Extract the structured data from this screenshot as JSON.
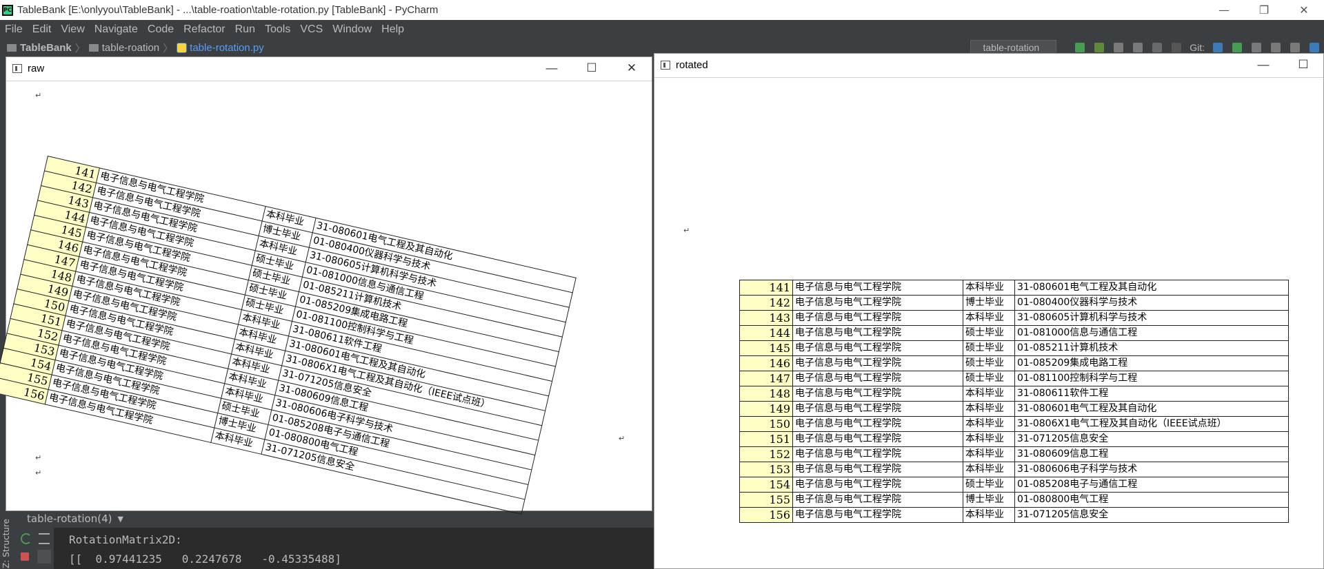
{
  "window": {
    "title": "TableBank [E:\\onlyyou\\TableBank] - ...\\table-roation\\table-rotation.py [TableBank] - PyCharm",
    "app_icon_text": "PC"
  },
  "menu": {
    "items": [
      "File",
      "Edit",
      "View",
      "Navigate",
      "Code",
      "Refactor",
      "Run",
      "Tools",
      "VCS",
      "Window",
      "Help"
    ]
  },
  "breadcrumb": {
    "project": "TableBank",
    "folder": "table-roation",
    "file": "table-rotation.py"
  },
  "toolbar": {
    "run_config": "table-rotation",
    "git_label": "Git:"
  },
  "sidebar": {
    "structure_label": "Z: Structure"
  },
  "run_panel": {
    "tab_label": "table-rotation(4)",
    "output_line1": "RotationMatrix2D:",
    "output_line2": "[[  0.97441235   0.2247678   -0.45335488]"
  },
  "raw_window": {
    "title": "raw"
  },
  "rotated_window": {
    "title": "rotated"
  },
  "table": {
    "rows": [
      {
        "num": "141",
        "school": "电子信息与电气工程学院",
        "degree": "本科毕业",
        "major": "31-080601电气工程及其自动化"
      },
      {
        "num": "142",
        "school": "电子信息与电气工程学院",
        "degree": "博士毕业",
        "major": "01-080400仪器科学与技术"
      },
      {
        "num": "143",
        "school": "电子信息与电气工程学院",
        "degree": "本科毕业",
        "major": "31-080605计算机科学与技术"
      },
      {
        "num": "144",
        "school": "电子信息与电气工程学院",
        "degree": "硕士毕业",
        "major": "01-081000信息与通信工程"
      },
      {
        "num": "145",
        "school": "电子信息与电气工程学院",
        "degree": "硕士毕业",
        "major": "01-085211计算机技术"
      },
      {
        "num": "146",
        "school": "电子信息与电气工程学院",
        "degree": "硕士毕业",
        "major": "01-085209集成电路工程"
      },
      {
        "num": "147",
        "school": "电子信息与电气工程学院",
        "degree": "硕士毕业",
        "major": "01-081100控制科学与工程"
      },
      {
        "num": "148",
        "school": "电子信息与电气工程学院",
        "degree": "本科毕业",
        "major": "31-080611软件工程"
      },
      {
        "num": "149",
        "school": "电子信息与电气工程学院",
        "degree": "本科毕业",
        "major": "31-080601电气工程及其自动化"
      },
      {
        "num": "150",
        "school": "电子信息与电气工程学院",
        "degree": "本科毕业",
        "major": "31-0806X1电气工程及其自动化（IEEE试点班）"
      },
      {
        "num": "151",
        "school": "电子信息与电气工程学院",
        "degree": "本科毕业",
        "major": "31-071205信息安全"
      },
      {
        "num": "152",
        "school": "电子信息与电气工程学院",
        "degree": "本科毕业",
        "major": "31-080609信息工程"
      },
      {
        "num": "153",
        "school": "电子信息与电气工程学院",
        "degree": "本科毕业",
        "major": "31-080606电子科学与技术"
      },
      {
        "num": "154",
        "school": "电子信息与电气工程学院",
        "degree": "硕士毕业",
        "major": "01-085208电子与通信工程"
      },
      {
        "num": "155",
        "school": "电子信息与电气工程学院",
        "degree": "博士毕业",
        "major": "01-080800电气工程"
      },
      {
        "num": "156",
        "school": "电子信息与电气工程学院",
        "degree": "本科毕业",
        "major": "31-071205信息安全"
      }
    ]
  },
  "colors": {
    "ide_bg": "#3c3f41",
    "console_bg": "#2b2b2b",
    "number_cell": "#ffffc5",
    "file_link": "#589df6"
  }
}
